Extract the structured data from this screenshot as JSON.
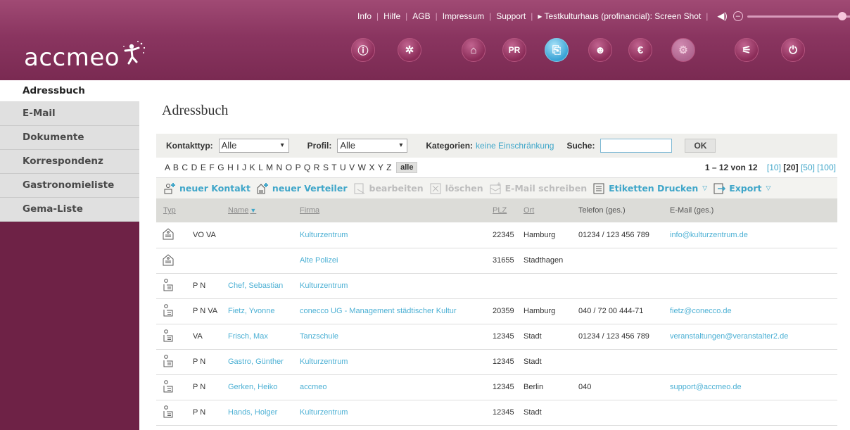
{
  "topbar": {
    "links": [
      "Info",
      "Hilfe",
      "AGB",
      "Impressum",
      "Support"
    ],
    "account": "▸ Testkulturhaus (profinancial): Screen Shot",
    "volume_minus": "–",
    "volume_plus": "+",
    "volume_level": 0.9
  },
  "logo": {
    "text": "accmeo"
  },
  "nav_icons": [
    {
      "name": "info",
      "glyph": "ⓘ",
      "active": false
    },
    {
      "name": "network",
      "glyph": "✲",
      "active": false
    },
    {
      "name": "home",
      "glyph": "⌂",
      "active": false
    },
    {
      "name": "pr",
      "glyph": "PR",
      "active": false
    },
    {
      "name": "paperclip",
      "glyph": "⎘",
      "active": true
    },
    {
      "name": "people",
      "glyph": "☻",
      "active": false
    },
    {
      "name": "euro",
      "glyph": "€",
      "active": false
    },
    {
      "name": "settings",
      "glyph": "⚙",
      "active": false,
      "dim": true
    },
    {
      "name": "mixer",
      "glyph": "⚟",
      "active": false
    },
    {
      "name": "power",
      "glyph": "⏻",
      "active": false
    }
  ],
  "sidebar": {
    "items": [
      {
        "label": "Adressbuch",
        "active": true
      },
      {
        "label": "E-Mail",
        "active": false
      },
      {
        "label": "Dokumente",
        "active": false
      },
      {
        "label": "Korrespondenz",
        "active": false
      },
      {
        "label": "Gastronomieliste",
        "active": false
      },
      {
        "label": "Gema-Liste",
        "active": false
      }
    ]
  },
  "page": {
    "title": "Adressbuch"
  },
  "filters": {
    "kontakttyp_label": "Kontakttyp:",
    "kontakttyp_value": "Alle",
    "profil_label": "Profil:",
    "profil_value": "Alle",
    "kategorien_label": "Kategorien:",
    "kategorien_value": "keine Einschränkung",
    "suche_label": "Suche:",
    "suche_value": "",
    "ok_label": "OK"
  },
  "alphabet": {
    "letters": "A B C D E F G H I J K L M N O P Q R S T U V W X Y Z",
    "all_label": "alle"
  },
  "paging": {
    "range": "1 – 12 von 12",
    "size_10": "[10]",
    "size_20": "[20]",
    "size_50": "[50]",
    "size_100": "[100]"
  },
  "actions": {
    "new_contact": "neuer Kontakt",
    "new_list": "neuer Verteiler",
    "edit": "bearbeiten",
    "delete": "löschen",
    "email": "E-Mail schreiben",
    "labels": "Etiketten Drucken",
    "export": "Export"
  },
  "table": {
    "headers": {
      "typ": "Typ",
      "name": "Name",
      "firma": "Firma",
      "plz": "PLZ",
      "ort": "Ort",
      "telefon": "Telefon (ges.)",
      "email": "E-Mail (ges.)"
    },
    "rows": [
      {
        "kind": "org",
        "typ": "VO VA",
        "name": "",
        "firma": "Kulturzentrum",
        "plz": "22345",
        "ort": "Hamburg",
        "telefon": "01234 / 123 456 789",
        "email": "info@kulturzentrum.de"
      },
      {
        "kind": "org",
        "typ": "",
        "name": "",
        "firma": "Alte Polizei",
        "plz": "31655",
        "ort": "Stadthagen",
        "telefon": "",
        "email": ""
      },
      {
        "kind": "person",
        "typ": "P N",
        "name": "Chef, Sebastian",
        "firma": "Kulturzentrum",
        "plz": "",
        "ort": "",
        "telefon": "",
        "email": ""
      },
      {
        "kind": "person",
        "typ": "P N VA",
        "name": "Fietz, Yvonne",
        "firma": "conecco UG - Management städtischer Kultur",
        "plz": "20359",
        "ort": "Hamburg",
        "telefon": "040 / 72 00 444-71",
        "email": "fietz@conecco.de"
      },
      {
        "kind": "person",
        "typ": "VA",
        "name": "Frisch, Max",
        "firma": "Tanzschule",
        "plz": "12345",
        "ort": "Stadt",
        "telefon": "01234 / 123 456 789",
        "email": "veranstaltungen@veranstalter2.de"
      },
      {
        "kind": "person",
        "typ": "P N",
        "name": "Gastro, Günther",
        "firma": "Kulturzentrum",
        "plz": "12345",
        "ort": "Stadt",
        "telefon": "",
        "email": ""
      },
      {
        "kind": "person",
        "typ": "P N",
        "name": "Gerken, Heiko",
        "firma": "accmeo",
        "plz": "12345",
        "ort": "Berlin",
        "telefon": "040",
        "email": "support@accmeo.de"
      },
      {
        "kind": "person",
        "typ": "P N",
        "name": "Hands, Holger",
        "firma": "Kulturzentrum",
        "plz": "12345",
        "ort": "Stadt",
        "telefon": "",
        "email": ""
      }
    ]
  }
}
